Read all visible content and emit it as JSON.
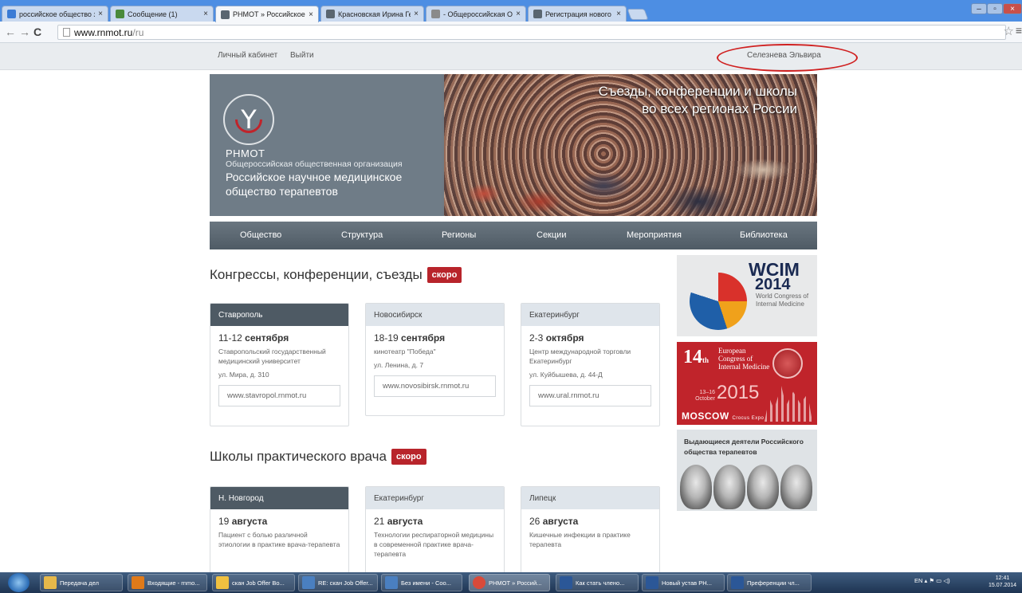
{
  "browser": {
    "tabs": [
      {
        "title": "российское общество за",
        "favicon_color": "#3a7bd5"
      },
      {
        "title": "Сообщение (1)",
        "favicon_color": "#4a8a3a"
      },
      {
        "title": "РНМОТ » Российское на",
        "favicon_color": "#5a6670",
        "active": true
      },
      {
        "title": "Красновская Ирина Георг",
        "favicon_color": "#5a6670"
      },
      {
        "title": "- Общероссийская Общ",
        "favicon_color": "#8a8a8a"
      },
      {
        "title": "Регистрация нового учас",
        "favicon_color": "#5a6670"
      }
    ],
    "close_glyph": "×",
    "url_host": "www.rnmot.ru",
    "url_path": "/ru"
  },
  "topbar": {
    "cabinet": "Личный кабинет",
    "logout": "Выйти",
    "user": "Селезнева Эльвира"
  },
  "hero": {
    "brand": "РНМОТ",
    "org_line1": "Общероссийская общественная организация",
    "org_line2": "Российское научное медицинское общество терапевтов",
    "slogan_line1": "Съезды, конференции и школы",
    "slogan_line2": "во всех регионах России"
  },
  "nav": [
    "Общество",
    "Структура",
    "Регионы",
    "Секции",
    "Мероприятия",
    "Библиотека"
  ],
  "congress": {
    "title": "Конгрессы, конференции, съезды",
    "badge": "скоро",
    "cards": [
      {
        "city": "Ставрополь",
        "days": "11-12",
        "month": "сентября",
        "place": "Ставропольский государственный медицинский университет",
        "address": "ул. Мира, д. 310",
        "site": "www.stavropol.rnmot.ru"
      },
      {
        "city": "Новосибирск",
        "days": "18-19",
        "month": "сентября",
        "place": "кинотеатр \"Победа\"",
        "address": "ул. Ленина, д. 7",
        "site": "www.novosibirsk.rnmot.ru"
      },
      {
        "city": "Екатеринбург",
        "days": "2-3",
        "month": "октября",
        "place": "Центр международной торговли Екатеринбург",
        "address": "ул. Куйбышева, д. 44-Д",
        "site": "www.ural.rnmot.ru"
      }
    ]
  },
  "schools": {
    "title": "Школы практического врача",
    "badge": "скоро",
    "cards": [
      {
        "city": "Н. Новгород",
        "day": "19",
        "month": "августа",
        "desc": "Пациент с болью различной этиологии в практике врача-терапевта"
      },
      {
        "city": "Екатеринбург",
        "day": "21",
        "month": "августа",
        "desc": "Технологии респираторной медицины в современной практике врача-терапевта"
      },
      {
        "city": "Липецк",
        "day": "26",
        "month": "августа",
        "desc": "Кишечные инфекции в практике терапевта"
      }
    ]
  },
  "banners": {
    "wcim": {
      "title": "WCIM",
      "year": "2014",
      "sub": "World Congress of Internal Medicine"
    },
    "ecim": {
      "num": "14",
      "suffix": "th",
      "title": "European Congress of Internal Medicine",
      "dates": "13–16 October",
      "year": "2015",
      "city": "MOSCOW",
      "venue": "Crocus Expo"
    },
    "people": {
      "title": "Выдающиеся деятели Российского общества терапевтов"
    }
  },
  "taskbar": {
    "items": [
      {
        "label": "Передача дел",
        "color": "#e6b84a"
      },
      {
        "label": "Входящие - rnmo...",
        "color": "#e07a1a"
      },
      {
        "label": "скан Job Offer Bo...",
        "color": "#f0c040"
      },
      {
        "label": "RE: скан Job Offer...",
        "color": "#4a7fc0"
      },
      {
        "label": "Без имени - Соо...",
        "color": "#4a7fc0"
      },
      {
        "label": "РНМОТ » Россий...",
        "color": "#d84a3a"
      },
      {
        "label": "Как стать члено...",
        "color": "#2b5797"
      },
      {
        "label": "Новый устав РН...",
        "color": "#2b5797"
      },
      {
        "label": "Преференции чл...",
        "color": "#2b5797"
      }
    ],
    "lang": "EN",
    "time": "12:41",
    "date": "15.07.2014"
  }
}
